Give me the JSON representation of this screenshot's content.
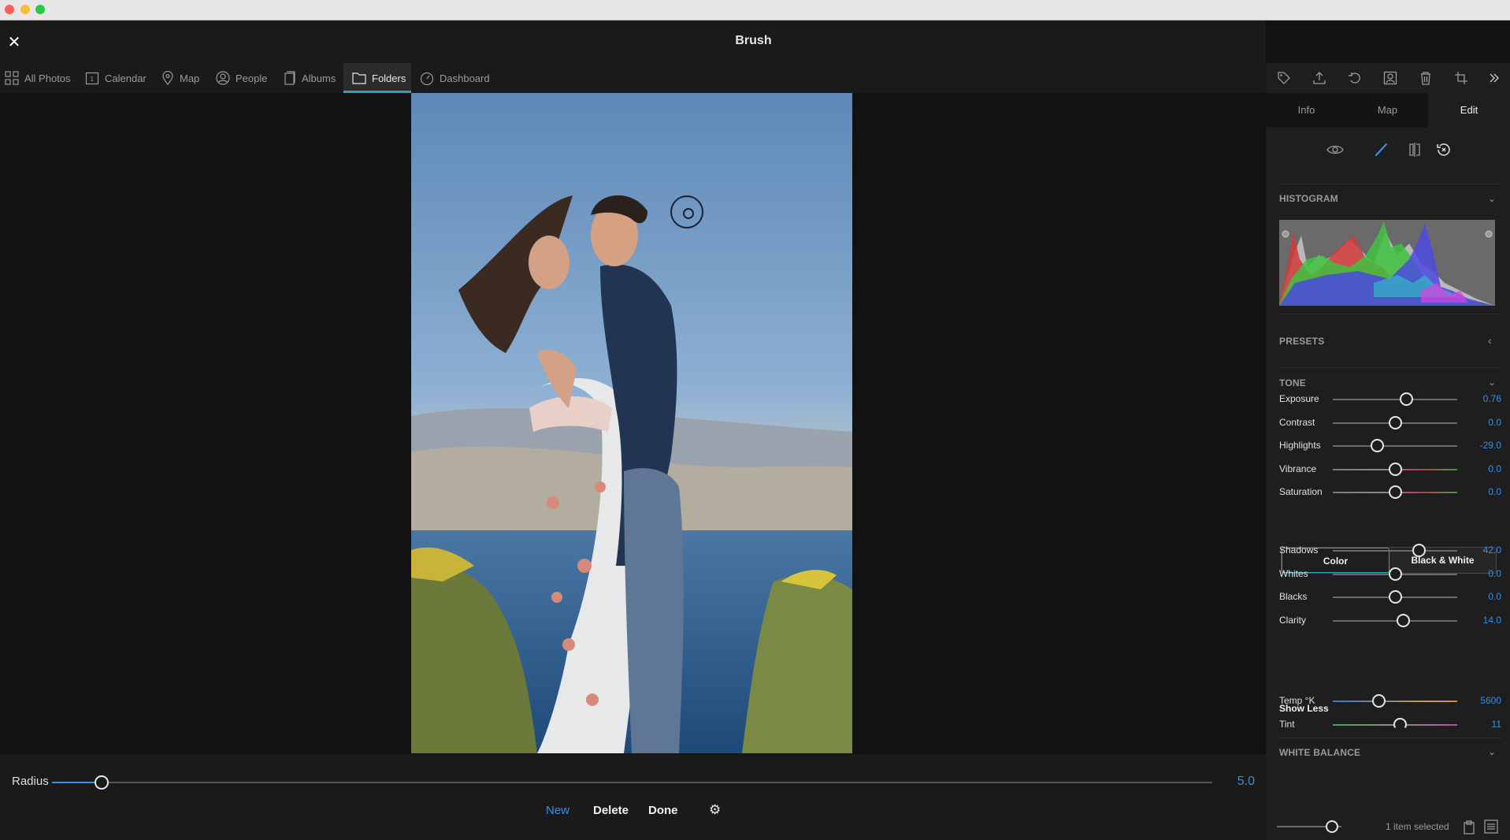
{
  "window": {
    "title": "Brush"
  },
  "nav": {
    "items": [
      {
        "label": "All Photos",
        "icon": "grid-icon"
      },
      {
        "label": "Calendar",
        "icon": "calendar-icon"
      },
      {
        "label": "Map",
        "icon": "pin-icon"
      },
      {
        "label": "People",
        "icon": "person-icon"
      },
      {
        "label": "Albums",
        "icon": "album-icon"
      },
      {
        "label": "Folders",
        "icon": "folder-icon",
        "active": true
      },
      {
        "label": "Dashboard",
        "icon": "gauge-icon"
      }
    ]
  },
  "panel": {
    "toolbar_icons": [
      "tag-icon",
      "share-icon",
      "rotate-icon",
      "faces-icon",
      "trash-icon",
      "crop-icon",
      "chevrons-right-icon"
    ],
    "tabs": [
      {
        "label": "Info"
      },
      {
        "label": "Map"
      },
      {
        "label": "Edit",
        "active": true
      }
    ],
    "mode_icons": [
      "eye-icon",
      "brush-icon",
      "compare-icon",
      "revert-icon"
    ],
    "histogram": {
      "title": "HISTOGRAM"
    },
    "presets": {
      "title": "PRESETS"
    },
    "tone": {
      "title": "TONE",
      "sliders": [
        {
          "label": "Exposure",
          "value": "0.76",
          "pos": 0.59
        },
        {
          "label": "Contrast",
          "value": "0.0",
          "pos": 0.5
        },
        {
          "label": "Highlights",
          "value": "-29.0",
          "pos": 0.355
        },
        {
          "label": "Vibrance",
          "value": "0.0",
          "pos": 0.5
        },
        {
          "label": "Saturation",
          "value": "0.0",
          "pos": 0.5
        }
      ],
      "color_mode": {
        "color": "Color",
        "bw": "Black & White"
      },
      "sliders2": [
        {
          "label": "Shadows",
          "value": "42.0",
          "pos": 0.69
        },
        {
          "label": "Whites",
          "value": "0.0",
          "pos": 0.5
        },
        {
          "label": "Blacks",
          "value": "0.0",
          "pos": 0.5
        },
        {
          "label": "Clarity",
          "value": "14.0",
          "pos": 0.565
        }
      ],
      "show_less": "Show Less"
    },
    "white_balance": {
      "title": "WHITE BALANCE",
      "sliders": [
        {
          "label": "Temp °K",
          "value": "5600",
          "pos": 0.37
        },
        {
          "label": "Tint",
          "value": "11",
          "pos": 0.54
        }
      ]
    },
    "footer": {
      "selection": "1 item selected",
      "thumb_size": 0.85
    }
  },
  "brush": {
    "radius_label": "Radius",
    "radius_value": "5.0",
    "radius_pos": 0.043,
    "buttons": {
      "new": "New",
      "delete": "Delete",
      "done": "Done"
    }
  },
  "colors": {
    "accent": "#3a8ee6",
    "teal": "#2aa6b8"
  }
}
